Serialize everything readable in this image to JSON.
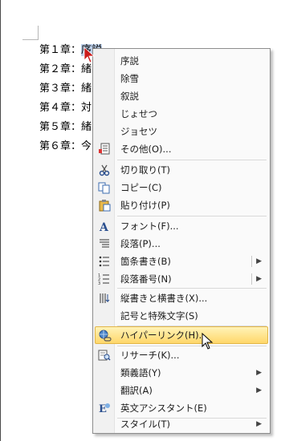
{
  "document": {
    "lines": [
      {
        "head": "第１章：",
        "tail": "序説",
        "selected": true
      },
      {
        "head": "第２章：",
        "tail": "緒"
      },
      {
        "head": "第３章：",
        "tail": "緒"
      },
      {
        "head": "第４章：",
        "tail": "対"
      },
      {
        "head": "第５章：",
        "tail": "緒"
      },
      {
        "head": "第６章：",
        "tail": "今"
      }
    ]
  },
  "menu": {
    "suggestions": [
      "序説",
      "除雪",
      "叙説",
      "じょせつ",
      "ジョセツ"
    ],
    "other": "その他(O)...",
    "cut": "切り取り(T)",
    "copy": "コピー(C)",
    "paste": "貼り付け(P)",
    "font": "フォント(F)...",
    "paragraph": "段落(P)...",
    "bullets": "箇条書き(B)",
    "numbering": "段落番号(N)",
    "text_direction": "縦書きと横書き(X)...",
    "symbols": "記号と特殊文字(S)",
    "hyperlink": "ハイパーリンク(H)...",
    "research": "リサーチ(K)...",
    "synonyms": "類義語(Y)",
    "translate": "翻訳(A)",
    "english_assistant": "英文アシスタント(E)",
    "styles": "スタイル(T)"
  },
  "colors": {
    "hover_top": "#fff3b8",
    "hover_bottom": "#ffd76a",
    "selection": "#bdd0ea"
  }
}
